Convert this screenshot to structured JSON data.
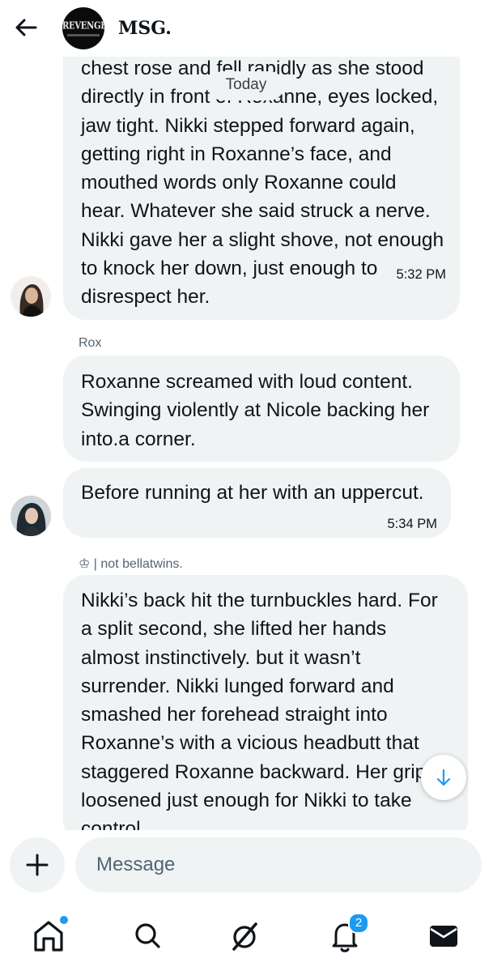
{
  "header": {
    "back_icon": "arrow-left-icon",
    "avatar_text": "REVENGE",
    "title": "MSG."
  },
  "date_divider": "Today",
  "messages": [
    {
      "text": "chest rose and fell rapidly as she stood\ndirectly in front of Roxanne, eyes locked,\njaw tight. Nikki stepped forward again,\ngetting right in Roxanne’s face, and\nmouthed words only Roxanne could\nhear. Whatever she said struck a nerve.\nNikki gave her a slight shove, not enough\nto knock her down, just enough to\ndisrespect her.",
      "time": "5:32 PM"
    },
    {
      "sender": "Rox",
      "text": "Roxanne screamed with loud content.\nSwinging violently at Nicole backing her\ninto.a corner."
    },
    {
      "text": "Before running at her with an uppercut.",
      "time": "5:34 PM"
    },
    {
      "sender": "♔ | not bellatwins.",
      "text": "Nikki’s back hit the turnbuckles hard. For\na split second, she lifted her hands\nalmost instinctively. but it wasn’t\nsurrender. Nikki lunged forward and\nsmashed her forehead straight into\nRoxanne’s with a vicious headbutt that\nstaggered Roxanne backward. Her grip\nloosened just enough for Nikki to take\ncontrol."
    }
  ],
  "composer": {
    "add_icon": "plus-icon",
    "placeholder": "Message"
  },
  "tabs": [
    {
      "name": "home",
      "icon": "home-icon",
      "has_dot": true
    },
    {
      "name": "search",
      "icon": "search-icon"
    },
    {
      "name": "grok",
      "icon": "grok-icon"
    },
    {
      "name": "notifications",
      "icon": "bell-icon",
      "badge": "2"
    },
    {
      "name": "messages",
      "icon": "envelope-icon"
    }
  ],
  "colors": {
    "bubble": "#eff3f4",
    "accent": "#1d9bf0",
    "text": "#0f1419",
    "muted": "#536471"
  }
}
